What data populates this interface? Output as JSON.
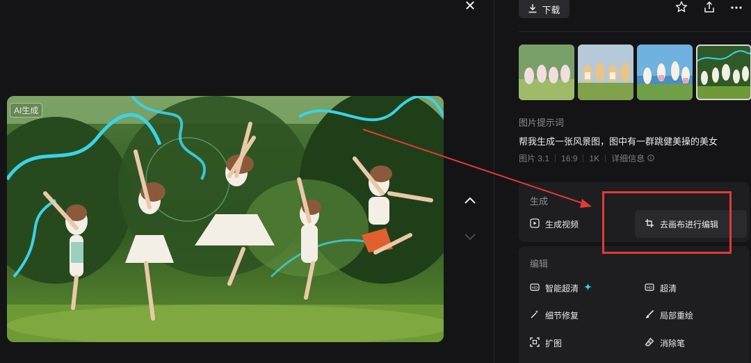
{
  "viewer": {
    "close_icon": "close-icon",
    "ai_badge": "AI生成",
    "nav_up_icon": "chevron-up-icon",
    "nav_down_icon": "chevron-down-icon"
  },
  "toolbar": {
    "download_label": "下载",
    "download_icon": "download-icon",
    "icons": [
      "star-icon",
      "share-icon",
      "more-icon"
    ]
  },
  "prompt": {
    "heading": "图片提示词",
    "text": "帮我生成一张风景图，图中有一群跳健美操的美女",
    "meta": [
      "图片 3.1",
      "16:9",
      "1K"
    ],
    "details_label": "详细信息"
  },
  "generate": {
    "heading": "生成",
    "video_label": "生成视频",
    "canvas_label": "去画布进行编辑"
  },
  "edit": {
    "heading": "编辑",
    "items": [
      {
        "label": "智能超清",
        "icon": "hd-icon"
      },
      {
        "label": "超清",
        "icon": "hd-icon"
      },
      {
        "label": "细节修复",
        "icon": "magic-wand-icon"
      },
      {
        "label": "局部重绘",
        "icon": "brush-icon"
      },
      {
        "label": "扩图",
        "icon": "expand-icon"
      },
      {
        "label": "消除笔",
        "icon": "eraser-icon"
      }
    ]
  },
  "colors": {
    "background": "#141416",
    "card": "#1e1e21",
    "highlight_box": "#e53935",
    "accent_sparkle": "#3ad3e8"
  }
}
